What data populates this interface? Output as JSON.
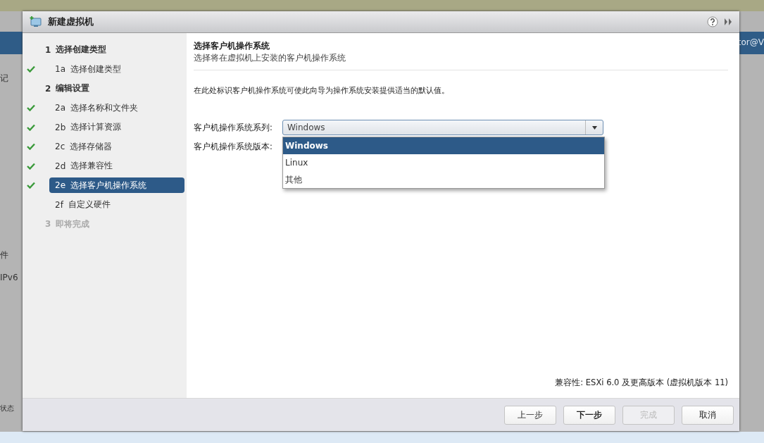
{
  "background": {
    "left_items": [
      "记",
      "件",
      "IPv6",
      "状态"
    ],
    "user": "tor@V"
  },
  "dialog": {
    "title": "新建虚拟机",
    "steps": [
      {
        "number": "1",
        "label": "选择创建类型",
        "done": false,
        "selected": false,
        "disabled": false,
        "children": [
          {
            "number": "1a",
            "label": "选择创建类型",
            "done": true,
            "selected": false,
            "disabled": false
          }
        ]
      },
      {
        "number": "2",
        "label": "编辑设置",
        "done": false,
        "selected": false,
        "disabled": false,
        "children": [
          {
            "number": "2a",
            "label": "选择名称和文件夹",
            "done": true,
            "selected": false,
            "disabled": false
          },
          {
            "number": "2b",
            "label": "选择计算资源",
            "done": true,
            "selected": false,
            "disabled": false
          },
          {
            "number": "2c",
            "label": "选择存储器",
            "done": true,
            "selected": false,
            "disabled": false
          },
          {
            "number": "2d",
            "label": "选择兼容性",
            "done": true,
            "selected": false,
            "disabled": false
          },
          {
            "number": "2e",
            "label": "选择客户机操作系统",
            "done": true,
            "selected": true,
            "disabled": false
          },
          {
            "number": "2f",
            "label": "自定义硬件",
            "done": false,
            "selected": false,
            "disabled": false
          }
        ]
      },
      {
        "number": "3",
        "label": "即将完成",
        "done": false,
        "selected": false,
        "disabled": true
      }
    ],
    "page": {
      "title": "选择客户机操作系统",
      "subtitle": "选择将在虚拟机上安装的客户机操作系统",
      "description": "在此处标识客户机操作系统可使此向导为操作系统安装提供适当的默认值。",
      "fields": [
        {
          "label": "客户机操作系统系列:",
          "value": "Windows",
          "expanded": true,
          "options": [
            {
              "label": "Windows",
              "selected": true
            },
            {
              "label": "Linux",
              "selected": false
            },
            {
              "label": "其他",
              "selected": false
            }
          ]
        },
        {
          "label": "客户机操作系统版本:"
        }
      ],
      "compatibility": "兼容性: ESXi 6.0 及更高版本 (虚拟机版本 11)"
    },
    "buttons": [
      {
        "label": "上一步",
        "disabled": false,
        "emphasized": false
      },
      {
        "label": "下一步",
        "disabled": false,
        "emphasized": true
      },
      {
        "label": "完成",
        "disabled": true,
        "emphasized": false
      },
      {
        "label": "取消",
        "disabled": false,
        "emphasized": false
      }
    ]
  }
}
